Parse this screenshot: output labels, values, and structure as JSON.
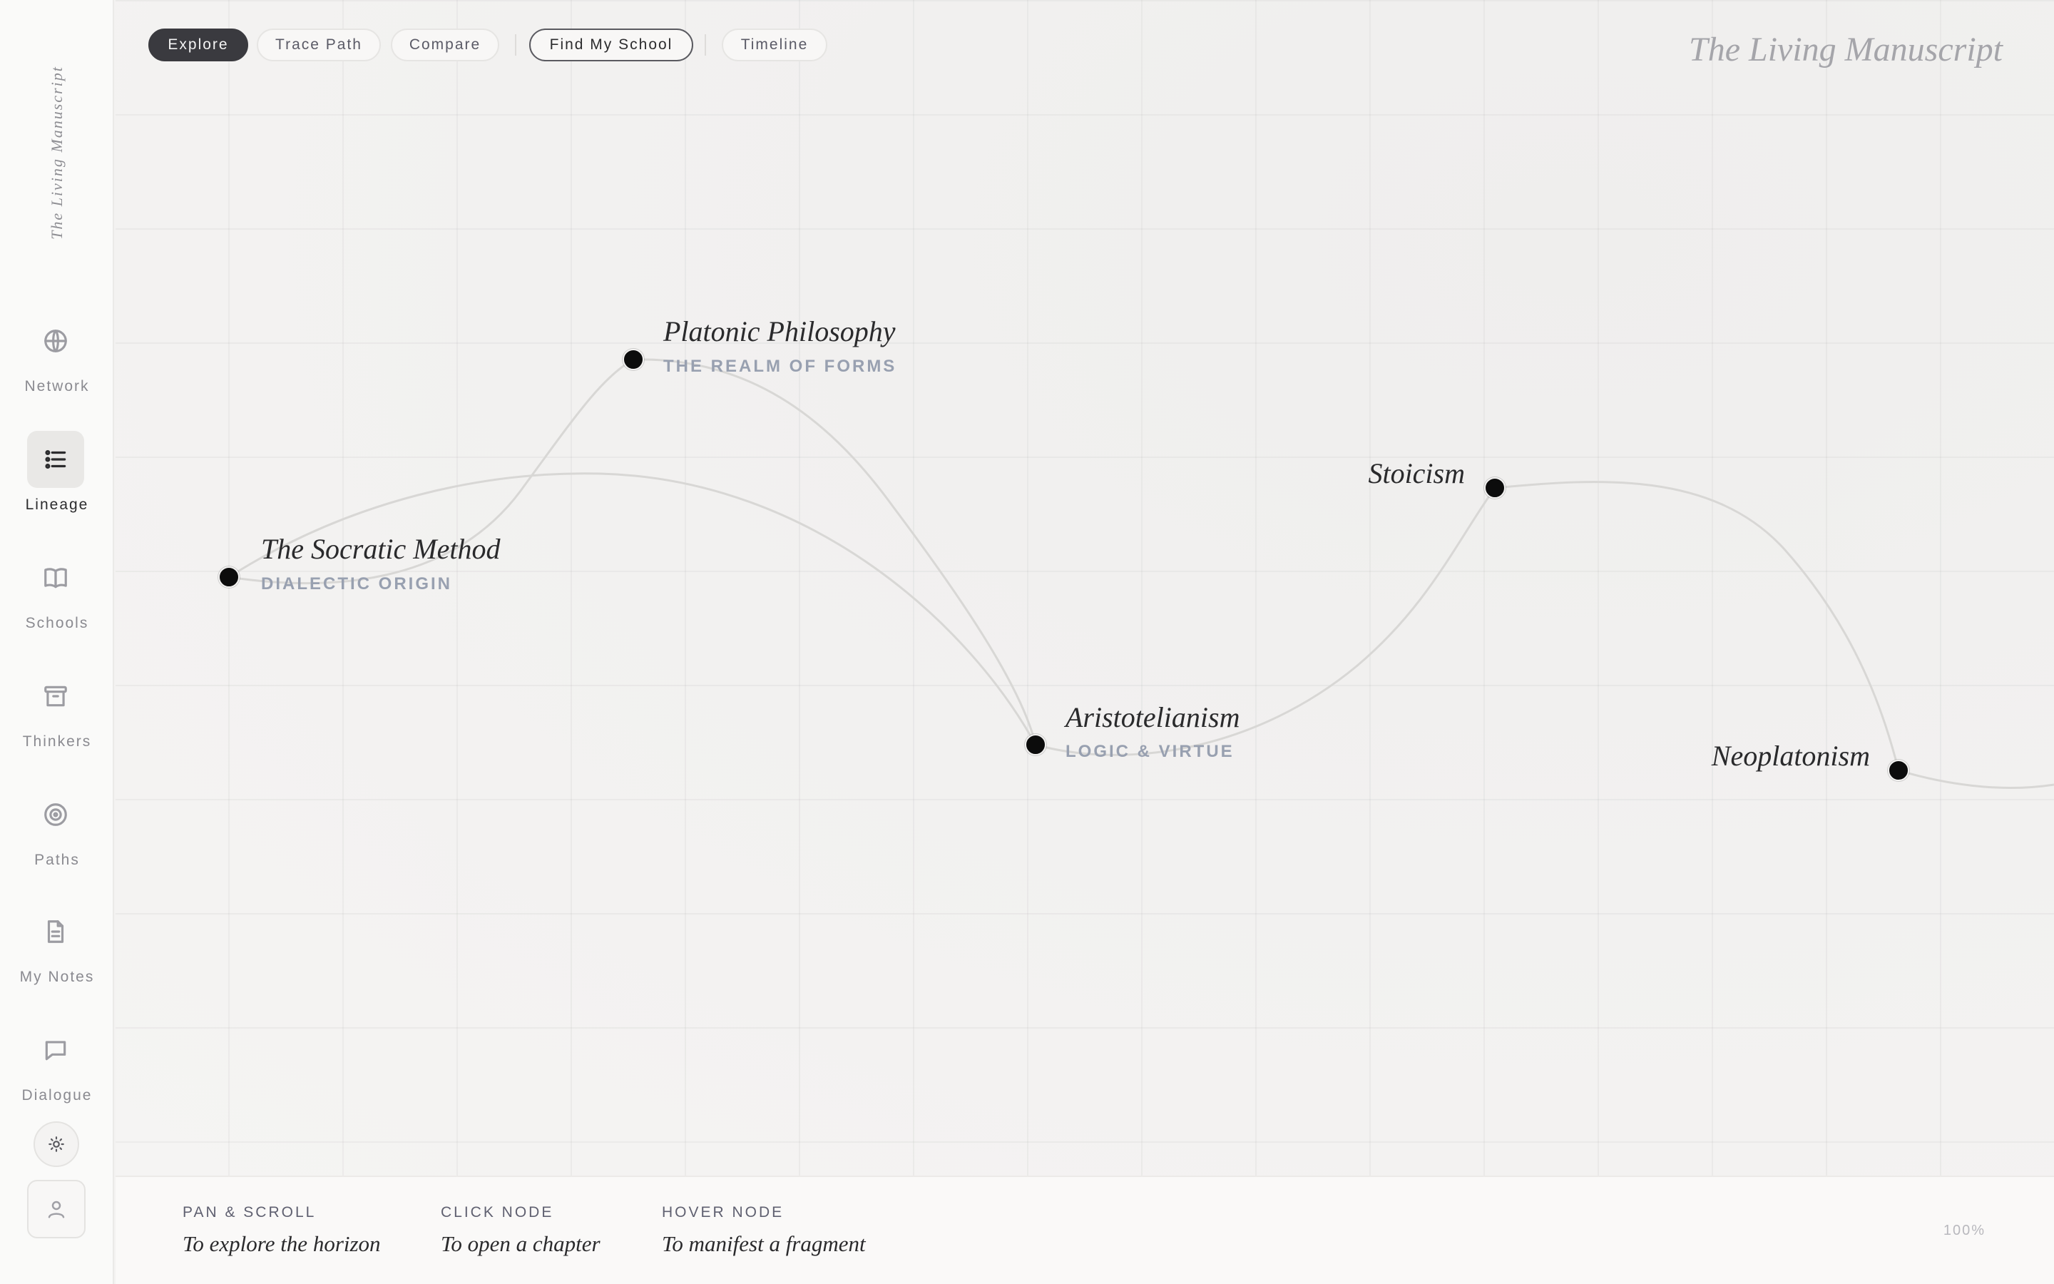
{
  "app": {
    "brand": "The Living Manuscript",
    "vertical_brand": "The Living Manuscript"
  },
  "sidebar": {
    "items": [
      {
        "label": "Network",
        "icon": "globe-icon"
      },
      {
        "label": "Lineage",
        "icon": "list-icon",
        "active": true
      },
      {
        "label": "Schools",
        "icon": "book-icon"
      },
      {
        "label": "Thinkers",
        "icon": "archive-icon"
      },
      {
        "label": "Paths",
        "icon": "target-icon"
      },
      {
        "label": "My Notes",
        "icon": "document-icon"
      },
      {
        "label": "Dialogue",
        "icon": "chat-icon"
      }
    ],
    "theme_icon": "sun-icon",
    "user_icon": "user-icon"
  },
  "toolbar": {
    "buttons": [
      {
        "label": "Explore",
        "state": "active"
      },
      {
        "label": "Trace Path"
      },
      {
        "label": "Compare"
      },
      {
        "label": "Find My School",
        "state": "outlined"
      },
      {
        "label": "Timeline"
      }
    ]
  },
  "graph": {
    "nodes": [
      {
        "id": "socratic",
        "title": "The Socratic Method",
        "subtitle": "DIALECTIC ORIGIN"
      },
      {
        "id": "platonic",
        "title": "Platonic Philosophy",
        "subtitle": "THE REALM OF FORMS"
      },
      {
        "id": "aristotelian",
        "title": "Aristotelianism",
        "subtitle": "LOGIC & VIRTUE"
      },
      {
        "id": "stoicism",
        "title": "Stoicism",
        "subtitle": ""
      },
      {
        "id": "neoplatonism",
        "title": "Neoplatonism",
        "subtitle": ""
      }
    ],
    "edges": [
      [
        "socratic",
        "platonic"
      ],
      [
        "socratic",
        "aristotelian"
      ],
      [
        "platonic",
        "aristotelian"
      ],
      [
        "aristotelian",
        "stoicism"
      ],
      [
        "stoicism",
        "neoplatonism"
      ]
    ],
    "colors": {
      "node": "#0c0c0c",
      "edge": "#d6d5d3",
      "subtitle": "#98a0b0"
    }
  },
  "footer": {
    "hints": [
      {
        "key": "PAN & SCROLL",
        "text": "To explore the horizon"
      },
      {
        "key": "CLICK NODE",
        "text": "To open a chapter"
      },
      {
        "key": "HOVER NODE",
        "text": "To manifest a fragment"
      }
    ],
    "zoom": "100%"
  }
}
